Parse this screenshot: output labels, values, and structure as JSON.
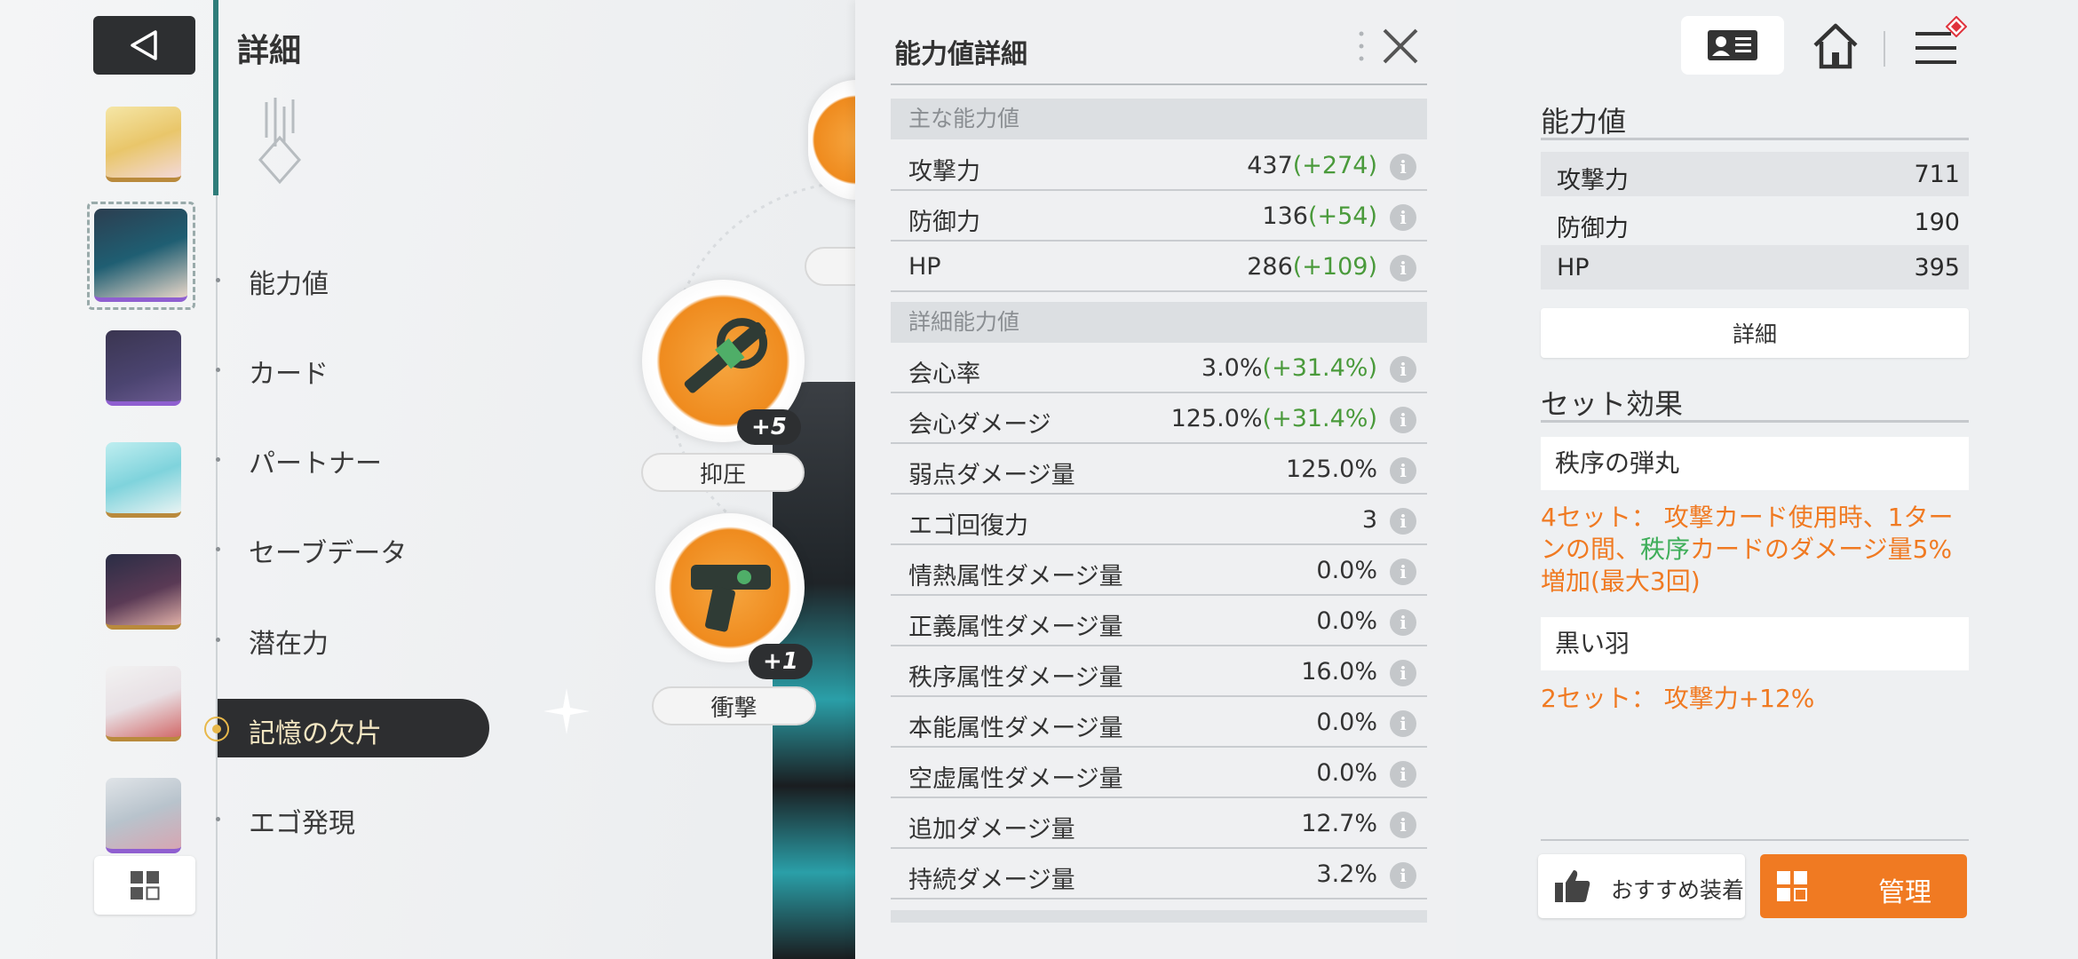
{
  "header": {
    "title": "詳細"
  },
  "menu": {
    "items": [
      "能力値",
      "カード",
      "パートナー",
      "セーブデータ",
      "潜在力",
      "記憶の欠片",
      "エゴ発現"
    ],
    "active": "記憶の欠片"
  },
  "equipment": [
    {
      "label": "抑圧",
      "level": "+5"
    },
    {
      "label": "衝撃",
      "level": "+1"
    }
  ],
  "stats_panel": {
    "title": "能力値詳細",
    "main_section": "主な能力値",
    "main": [
      {
        "name": "攻撃力",
        "base": "437",
        "bonus": "(+274)"
      },
      {
        "name": "防御力",
        "base": "136",
        "bonus": "(+54)"
      },
      {
        "name": "HP",
        "base": "286",
        "bonus": "(+109)"
      }
    ],
    "detail_section": "詳細能力値",
    "detail": [
      {
        "name": "会心率",
        "base": "3.0%",
        "bonus": "(+31.4%)"
      },
      {
        "name": "会心ダメージ",
        "base": "125.0%",
        "bonus": "(+31.4%)"
      },
      {
        "name": "弱点ダメージ量",
        "base": "125.0%",
        "bonus": ""
      },
      {
        "name": "エゴ回復力",
        "base": "3",
        "bonus": ""
      },
      {
        "name": "情熱属性ダメージ量",
        "base": "0.0%",
        "bonus": ""
      },
      {
        "name": "正義属性ダメージ量",
        "base": "0.0%",
        "bonus": ""
      },
      {
        "name": "秩序属性ダメージ量",
        "base": "16.0%",
        "bonus": ""
      },
      {
        "name": "本能属性ダメージ量",
        "base": "0.0%",
        "bonus": ""
      },
      {
        "name": "空虚属性ダメージ量",
        "base": "0.0%",
        "bonus": ""
      },
      {
        "name": "追加ダメージ量",
        "base": "12.7%",
        "bonus": ""
      },
      {
        "name": "持続ダメージ量",
        "base": "3.2%",
        "bonus": ""
      }
    ]
  },
  "right_panel": {
    "stats_title": "能力値",
    "stats": [
      {
        "name": "攻撃力",
        "value": "711"
      },
      {
        "name": "防御力",
        "value": "190"
      },
      {
        "name": "HP",
        "value": "395"
      }
    ],
    "detail_button": "詳細",
    "set_title": "セット効果",
    "sets": [
      {
        "name": "秩序の弾丸",
        "desc_parts": [
          "4セット： 攻撃カード使用時、1ターンの間、",
          "秩序",
          "カードのダメージ量5%増加(最大3回)"
        ]
      },
      {
        "name": "黒い羽",
        "desc_parts": [
          "2セット： 攻撃力+12%",
          "",
          ""
        ]
      }
    ],
    "recommend_button": "おすすめ装着",
    "manage_button": "管理"
  },
  "colors": {
    "accent_orange": "#f07a22",
    "bonus_green": "#4a9a3b",
    "dark_button": "#2d2f31",
    "teal_accent": "#2f7d7a"
  }
}
